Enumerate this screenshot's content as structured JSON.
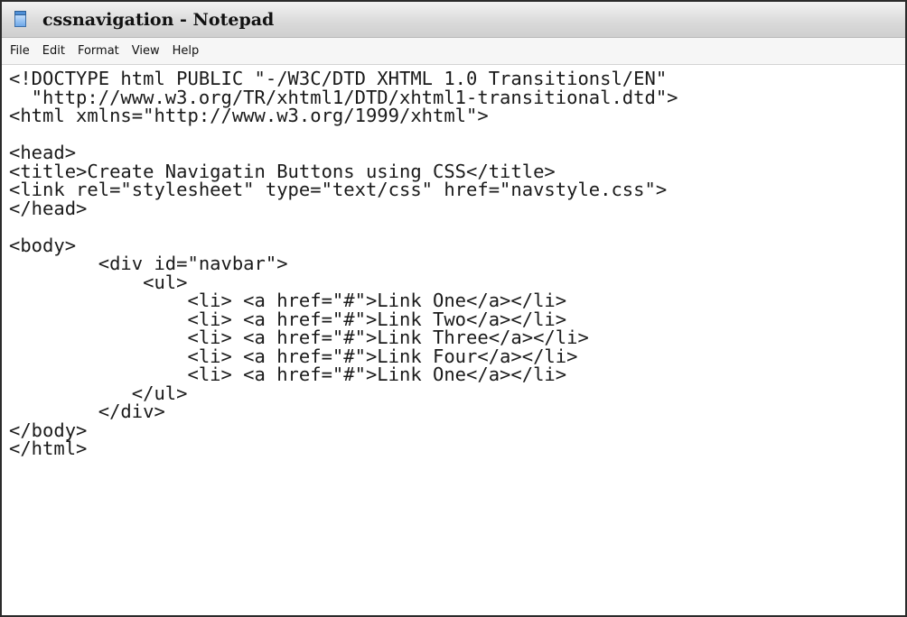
{
  "window": {
    "title": "cssnavigation - Notepad",
    "icon": "notepad-icon"
  },
  "menu": {
    "items": [
      "File",
      "Edit",
      "Format",
      "View",
      "Help"
    ]
  },
  "editor": {
    "lines": [
      "<!DOCTYPE html PUBLIC \"-/W3C/DTD XHTML 1.0 Transitionsl/EN\"",
      "  \"http://www.w3.org/TR/xhtml1/DTD/xhtml1-transitional.dtd\">",
      "<html xmlns=\"http://www.w3.org/1999/xhtml\">",
      "",
      "<head>",
      "<title>Create Navigatin Buttons using CSS</title>",
      "<link rel=\"stylesheet\" type=\"text/css\" href=\"navstyle.css\">",
      "</head>",
      "",
      "<body>",
      "        <div id=\"navbar\">",
      "            <ul>",
      "                <li> <a href=\"#\">Link One</a></li>",
      "                <li> <a href=\"#\">Link Two</a></li>",
      "                <li> <a href=\"#\">Link Three</a></li>",
      "                <li> <a href=\"#\">Link Four</a></li>",
      "                <li> <a href=\"#\">Link One</a></li>",
      "           </ul>",
      "        </div>",
      "</body>",
      "</html>"
    ]
  }
}
